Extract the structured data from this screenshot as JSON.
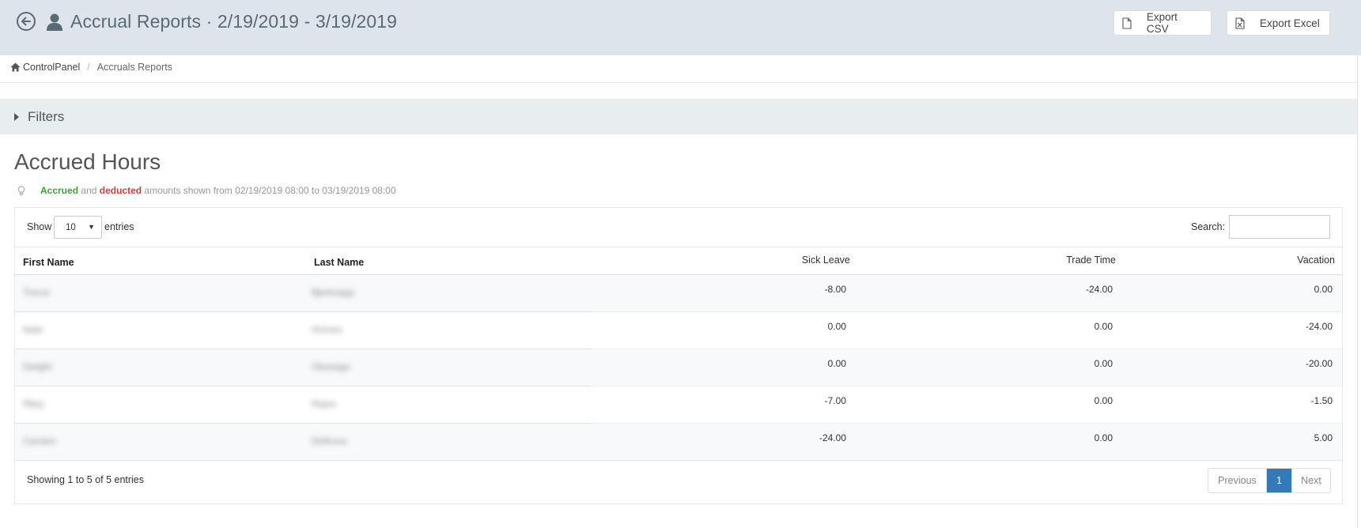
{
  "header": {
    "back_icon": "back-arrow-circle-icon",
    "user_icon": "user-icon",
    "title": "Accrual Reports · 2/19/2019 - 3/19/2019",
    "export_csv_label": "Export CSV",
    "export_csv_icon": "file-icon",
    "export_excel_label": "Export Excel",
    "export_excel_icon": "excel-file-icon",
    "background": "#dde5ea"
  },
  "breadcrumb": {
    "home_icon": "home-icon",
    "home_label": "ControlPanel",
    "separator": "/",
    "current": "Accruals Reports"
  },
  "filters": {
    "label": "Filters",
    "icon": "caret-right-icon"
  },
  "section": {
    "title": "Accrued Hours",
    "info_icon": "lightbulb-icon",
    "info_accrued": "Accrued",
    "info_and": " and ",
    "info_deducted": "deducted",
    "info_rest": " amounts shown from 02/19/2019 08:00 to 03/19/2019 08:00",
    "accrued_color": "#3aa33a",
    "deducted_color": "#d9383a"
  },
  "table_controls": {
    "show_label": "Show",
    "page_length": "10",
    "entries_label": "entries",
    "search_label": "Search:",
    "search_value": ""
  },
  "table": {
    "columns": [
      "First Name",
      "Last Name",
      "Sick Leave",
      "Trade Time",
      "Vacation"
    ],
    "rows": [
      {
        "first": "Trevor",
        "last": "Bjerknapp",
        "sick": "-8.00",
        "trade": "-24.00",
        "vacation": "0.00"
      },
      {
        "first": "Nate",
        "last": "Grimes",
        "sick": "0.00",
        "trade": "0.00",
        "vacation": "-24.00"
      },
      {
        "first": "Dwight",
        "last": "Okonego",
        "sick": "0.00",
        "trade": "0.00",
        "vacation": "-20.00"
      },
      {
        "first": "Riley",
        "last": "Rejon",
        "sick": "-7.00",
        "trade": "0.00",
        "vacation": "-1.50"
      },
      {
        "first": "Carsten",
        "last": "Delhuva",
        "sick": "-24.00",
        "trade": "0.00",
        "vacation": "5.00"
      }
    ]
  },
  "footer": {
    "info": "Showing 1 to 5 of 5 entries",
    "prev_label": "Previous",
    "current_page": "1",
    "next_label": "Next",
    "active_color": "#337ab7"
  }
}
